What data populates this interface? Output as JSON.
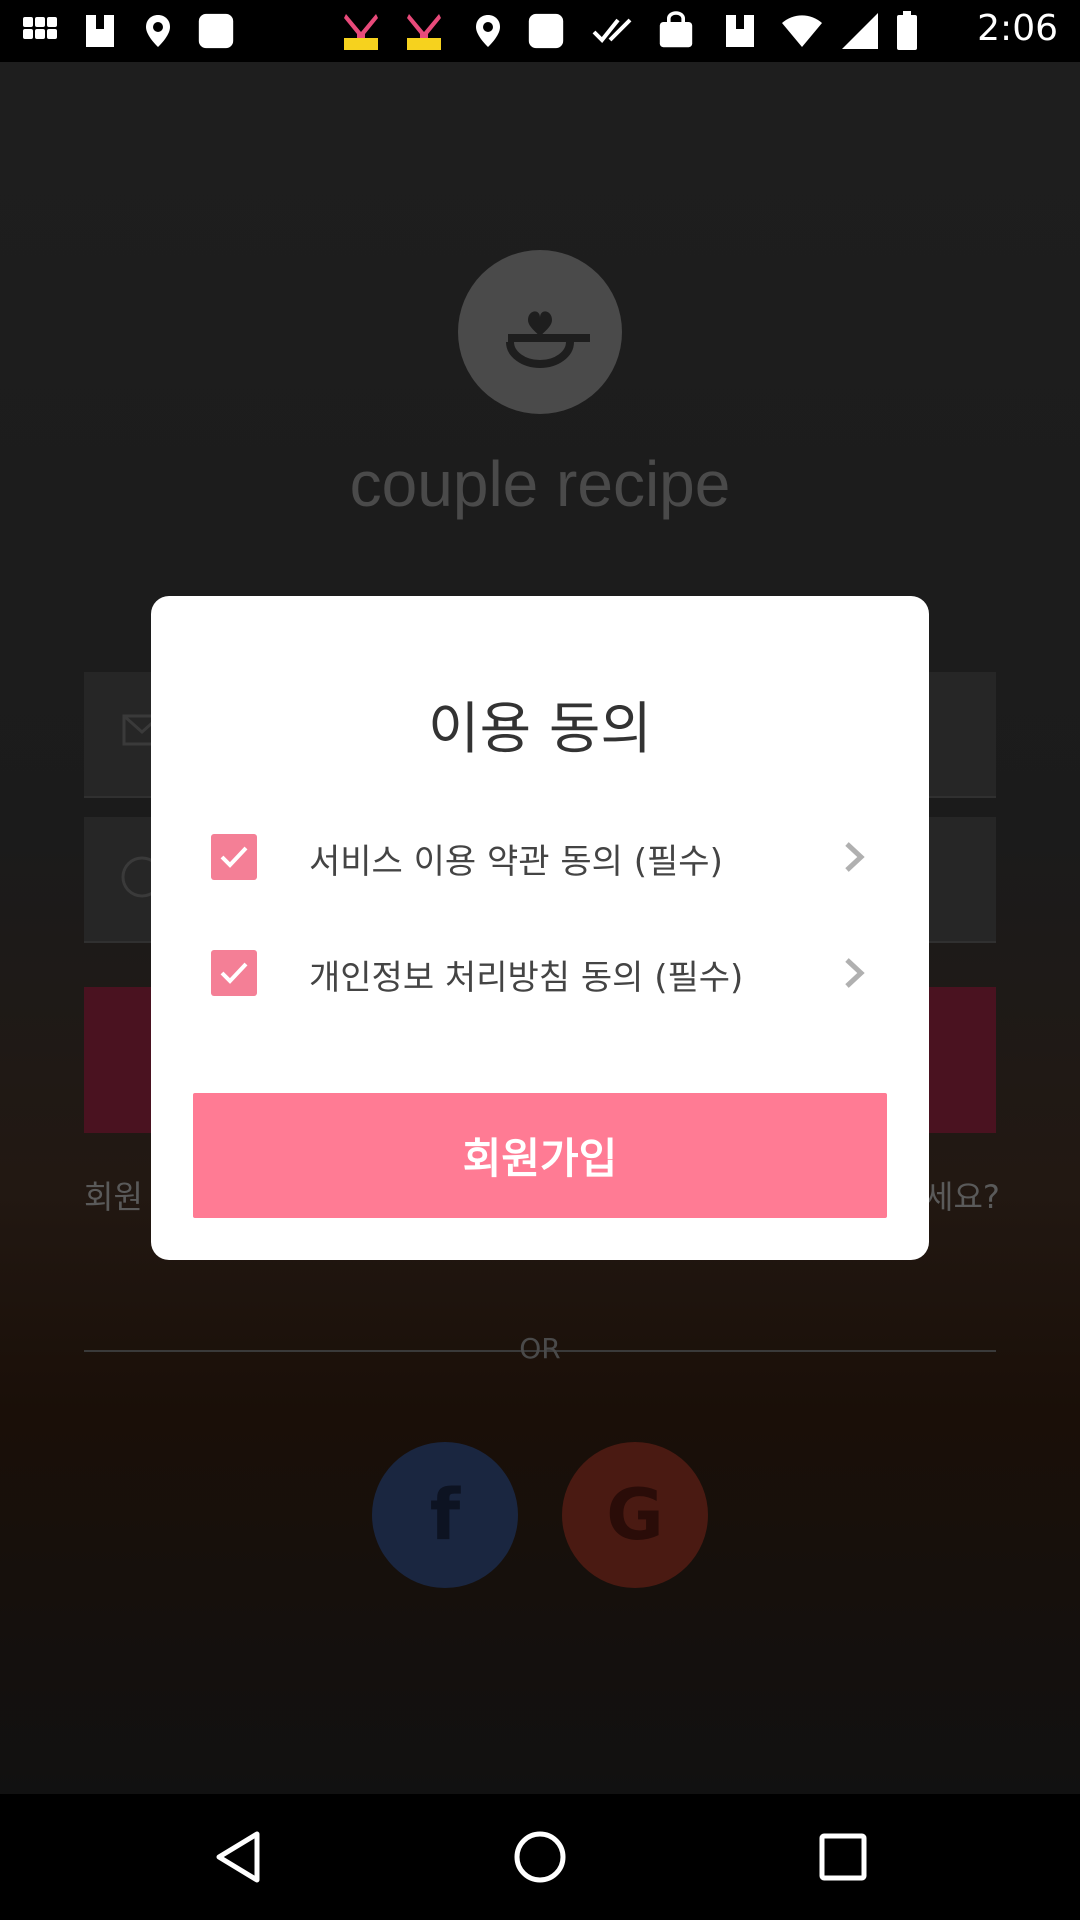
{
  "status_bar": {
    "time": "2:06",
    "icons": [
      "photos-icon",
      "store-icon",
      "location-icon",
      "app-icon",
      "kpop-icon",
      "kpop-icon",
      "location-icon",
      "app-icon",
      "check-icon",
      "bag-icon",
      "store-icon",
      "wifi-icon",
      "signal-icon",
      "battery-icon"
    ]
  },
  "background_app": {
    "logo_text": "couple recipe",
    "signup_link_partial": "회원",
    "forgot_link_partial": "세요?",
    "or_label": "OR",
    "facebook_glyph": "f",
    "google_glyph": "G"
  },
  "dialog": {
    "title": "이용 동의",
    "items": [
      {
        "label": "서비스 이용 약관 동의 (필수)",
        "checked": true
      },
      {
        "label": "개인정보 처리방침 동의 (필수)",
        "checked": true
      }
    ],
    "submit_label": "회원가입"
  },
  "colors": {
    "accent": "#ff7b94",
    "checkbox": "#f47f96"
  }
}
